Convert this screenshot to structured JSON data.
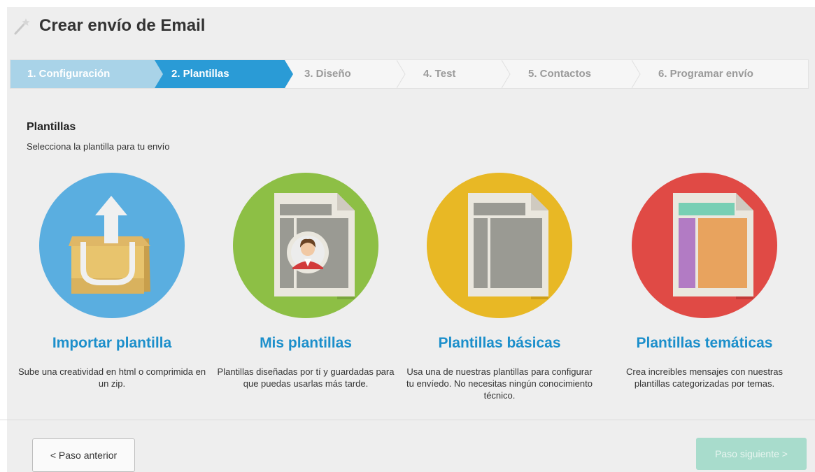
{
  "page": {
    "title": "Crear envío de Email"
  },
  "steps": [
    {
      "label": "1. Configuración",
      "state": "done"
    },
    {
      "label": "2. Plantillas",
      "state": "active"
    },
    {
      "label": "3. Diseño",
      "state": "pending"
    },
    {
      "label": "4. Test",
      "state": "pending"
    },
    {
      "label": "5. Contactos",
      "state": "pending"
    },
    {
      "label": "6. Programar envío",
      "state": "pending"
    }
  ],
  "section": {
    "title": "Plantillas",
    "subtitle": "Selecciona la plantilla para tu envío"
  },
  "options": [
    {
      "title": "Importar plantilla",
      "description": "Sube una creatividad en html o comprimida en un zip.",
      "icon": "upload-box-icon",
      "color": "#5aaee0"
    },
    {
      "title": "Mis plantillas",
      "description": "Plantillas diseñadas por tí y guardadas para que puedas usarlas más tarde.",
      "icon": "user-template-icon",
      "color": "#8dbf45"
    },
    {
      "title": "Plantillas básicas",
      "description": "Usa una de nuestras plantillas para configurar tu envíedo. No necesitas ningún conocimiento técnico.",
      "icon": "basic-template-icon",
      "color": "#e8b825"
    },
    {
      "title": "Plantillas temáticas",
      "description": "Crea increibles mensajes con nuestras plantillas categorizadas por temas.",
      "icon": "themed-template-icon",
      "color": "#e04a45"
    }
  ],
  "footer": {
    "prev_label": "< Paso anterior",
    "next_label": "Paso siguiente >"
  },
  "colors": {
    "accent": "#2a9bd6",
    "step_done": "#a9d3e8",
    "title_blue": "#1c8fcb",
    "next_disabled": "#a8dccc"
  }
}
